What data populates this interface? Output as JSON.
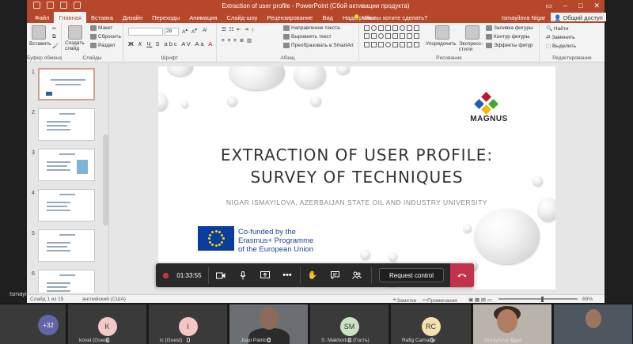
{
  "window": {
    "title": "Extraction of user profile - PowerPoint (Сбой активации продукта)",
    "user_name": "Ismayilova Nigar",
    "share_label": "Общий доступ"
  },
  "tabs": [
    {
      "label": "Файл",
      "active": false
    },
    {
      "label": "Главная",
      "active": true
    },
    {
      "label": "Вставка",
      "active": false
    },
    {
      "label": "Дизайн",
      "active": false
    },
    {
      "label": "Переходы",
      "active": false
    },
    {
      "label": "Анимация",
      "active": false
    },
    {
      "label": "Слайд-шоу",
      "active": false
    },
    {
      "label": "Рецензирование",
      "active": false
    },
    {
      "label": "Вид",
      "active": false
    },
    {
      "label": "Надстройки",
      "active": false
    }
  ],
  "tell_me": "Что вы хотите сделать?",
  "ribbon": {
    "clipboard": {
      "paste": "Вставить",
      "label": "Буфер обмена"
    },
    "slides": {
      "new_slide": "Создать слайд",
      "layout": "Макет",
      "reset": "Сбросить",
      "section": "Раздел",
      "label": "Слайды"
    },
    "font": {
      "size": "28",
      "label": "Шрифт"
    },
    "paragraph": {
      "text_direction": "Направление текста",
      "align_text": "Выровнять текст",
      "smartart": "Преобразовать в SmartArt",
      "label": "Абзац"
    },
    "drawing": {
      "arrange": "Упорядочить",
      "quick_styles": "Экспресс-стили",
      "fill": "Заливка фигуры",
      "outline": "Контур фигуры",
      "effects": "Эффекты фигур",
      "label": "Рисование"
    },
    "editing": {
      "find": "Найти",
      "replace": "Заменить",
      "select": "Выделить",
      "label": "Редактирование"
    }
  },
  "thumbnails": [
    "1",
    "2",
    "3",
    "4",
    "5",
    "6"
  ],
  "slide": {
    "title_line1": "EXTRACTION OF USER PROFILE:",
    "title_line2": "SURVEY OF TECHNIQUES",
    "author": "NIGAR ISMAYILOVA, AZERBAIJAN STATE OIL AND INDUSTRY UNIVERSITY",
    "logo": "MAGNUS",
    "eu_line1": "Co-funded by the",
    "eu_line2": "Erasmus+ Programme",
    "eu_line3": "of the European Union",
    "logo_colors": {
      "red": "#c8102e",
      "blue": "#1e5fb4",
      "green": "#3aa935",
      "yellow": "#f5b800"
    }
  },
  "status": {
    "slide_info": "Слайд 1 из 15",
    "language": "английский (США)",
    "notes": "Заметки",
    "comments": "Примечания",
    "zoom": "69%"
  },
  "meeting": {
    "timer": "01:33:55",
    "request_control": "Request control",
    "presenter": "Ismayilova Nigar"
  },
  "participants": {
    "more_count": "+32",
    "people": [
      {
        "initial": "K",
        "name": "koval (Guest)",
        "color": "#f2c8c8"
      },
      {
        "initial": "I",
        "name": "ic (Guest)",
        "color": "#f5c6c6"
      },
      {
        "initial": "",
        "name": "Joao Patricio",
        "color": ""
      },
      {
        "initial": "SM",
        "name": "S. Makhortov (Гость)",
        "color": "#c9e3c4"
      },
      {
        "initial": "RC",
        "name": "Rafig Camalov",
        "color": "#f5e0b0"
      },
      {
        "initial": "",
        "name": "Ismayilova Nigar",
        "color": ""
      }
    ]
  }
}
